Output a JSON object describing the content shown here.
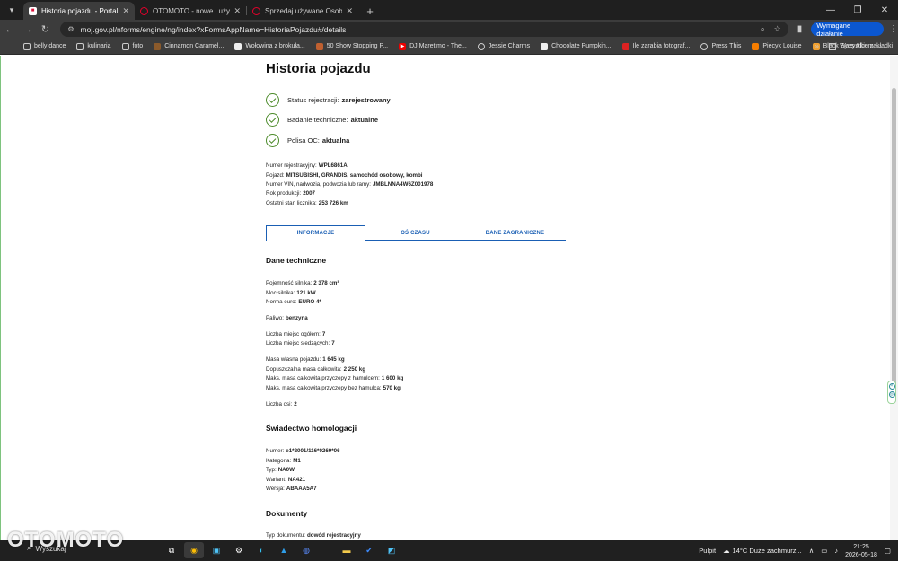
{
  "browser": {
    "tabs": [
      {
        "title": "Historia pojazdu - Portal gov.pl",
        "favicon_color": "#dc143c",
        "active": true
      },
      {
        "title": "OTOMOTO - nowe i używane sa",
        "favicon_color": "#e4002b",
        "active": false
      },
      {
        "title": "Sprzedaj używane Osobowe | O",
        "favicon_color": "#e4002b",
        "active": false
      }
    ],
    "url": "moj.gov.pl/nforms/engine/ng/index?xFormsAppName=HistoriaPojazdu#/details",
    "required_action_label": "Wymagane działanie",
    "bookmarks": [
      {
        "label": "belly dance",
        "icon": "folder-icon"
      },
      {
        "label": "kulinaria",
        "icon": "folder-icon"
      },
      {
        "label": "foto",
        "icon": "folder-icon"
      },
      {
        "label": "Cinnamon Caramel...",
        "icon": "site-icon"
      },
      {
        "label": "Wołowina z brokuła...",
        "icon": "site-icon"
      },
      {
        "label": "50 Show Stopping P...",
        "icon": "site-icon"
      },
      {
        "label": "DJ Maretimo - The...",
        "icon": "youtube-icon"
      },
      {
        "label": "Jessie Charms",
        "icon": "globe-icon"
      },
      {
        "label": "Chocolate Pumpkin...",
        "icon": "site-icon"
      },
      {
        "label": "Ile zarabia fotograf...",
        "icon": "site-icon"
      },
      {
        "label": "Press This",
        "icon": "globe-icon"
      },
      {
        "label": "Piecyk Louise",
        "icon": "blogger-icon"
      },
      {
        "label": "Black Eyes Album -...",
        "icon": "site-icon"
      }
    ],
    "all_bookmarks_label": "Wszystkie zakładki"
  },
  "page": {
    "title": "Historia pojazdu",
    "statuses": [
      {
        "label": "Status rejestracji:",
        "value": "zarejestrowany"
      },
      {
        "label": "Badanie techniczne:",
        "value": "aktualne"
      },
      {
        "label": "Polisa OC:",
        "value": "aktualna"
      }
    ],
    "vehicle_info": [
      {
        "label": "Numer rejestracyjny:",
        "value": "WPL6861A"
      },
      {
        "label": "Pojazd:",
        "value": "MITSUBISHI, GRANDIS, samochód osobowy, kombi"
      },
      {
        "label": "Numer VIN, nadwozia, podwozia lub ramy:",
        "value": "JMBLNNA4W6Z001978"
      },
      {
        "label": "Rok produkcji:",
        "value": "2007"
      },
      {
        "label": "Ostatni stan licznika:",
        "value": "253 726 km"
      }
    ],
    "tabs": [
      {
        "label": "INFORMACJE",
        "active": true
      },
      {
        "label": "OŚ CZASU",
        "active": false
      },
      {
        "label": "DANE ZAGRANICZNE",
        "active": false
      }
    ],
    "technical": {
      "title": "Dane techniczne",
      "rows": [
        {
          "label": "Pojemność silnika:",
          "value": "2 378 cm³"
        },
        {
          "label": "Moc silnika:",
          "value": "121 kW"
        },
        {
          "label": "Norma euro:",
          "value": "EURO 4*"
        },
        {
          "label": "Paliwo:",
          "value": "benzyna"
        },
        {
          "label": "Liczba miejsc ogółem:",
          "value": "7"
        },
        {
          "label": "Liczba miejsc siedzących:",
          "value": "7"
        },
        {
          "label": "Masa własna pojazdu:",
          "value": "1 645 kg"
        },
        {
          "label": "Dopuszczalna masa całkowita:",
          "value": "2 250 kg"
        },
        {
          "label": "Maks. masa całkowita przyczepy z hamulcem:",
          "value": "1 600 kg"
        },
        {
          "label": "Maks. masa całkowita przyczepy bez hamulca:",
          "value": "570 kg"
        },
        {
          "label": "Liczba osi:",
          "value": "2"
        }
      ]
    },
    "homologation": {
      "title": "Świadectwo homologacji",
      "rows": [
        {
          "label": "Numer:",
          "value": "e1*2001/116*0269*06"
        },
        {
          "label": "Kategoria:",
          "value": "M1"
        },
        {
          "label": "Typ:",
          "value": "NA0W"
        },
        {
          "label": "Wariant:",
          "value": "NA421"
        },
        {
          "label": "Wersja:",
          "value": "ABAAA5A7"
        }
      ]
    },
    "documents": {
      "title": "Dokumenty",
      "rows": [
        {
          "label": "Typ dokumentu:",
          "value": "dowód rejestracyjny"
        }
      ]
    }
  },
  "taskbar": {
    "overlay_text": "OTOMOTO",
    "search_label": "Wyszukaj",
    "desktop_label": "Pulpit",
    "weather": "14°C  Duże zachmurz...",
    "time": "21:25",
    "date": "2026-05-18"
  }
}
